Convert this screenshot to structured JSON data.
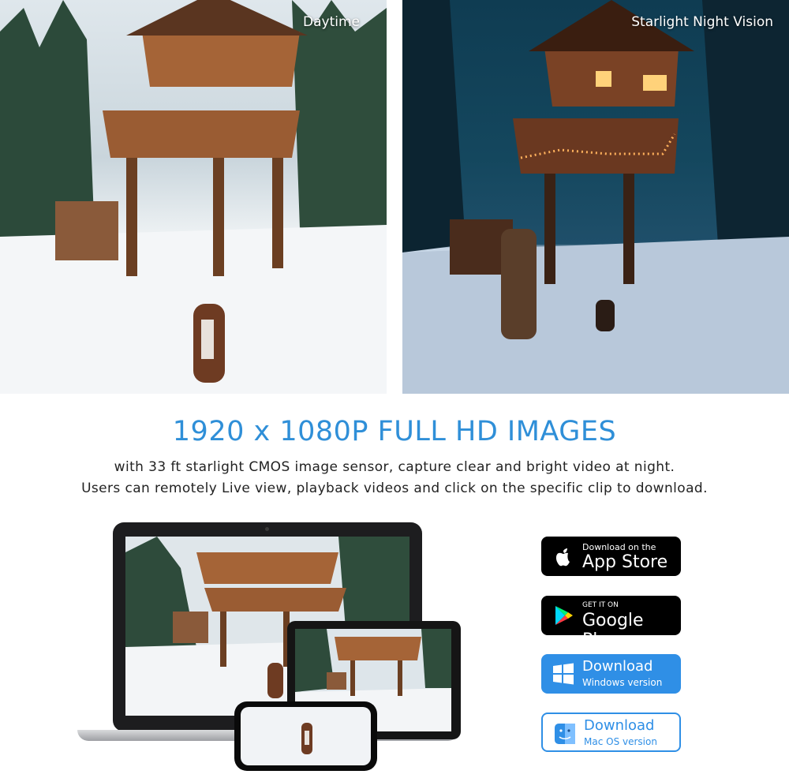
{
  "photos": {
    "day_label": "Daytime",
    "night_label": "Starlight Night Vision"
  },
  "headline": "1920 x 1080P FULL HD IMAGES",
  "description": [
    "with 33 ft starlight CMOS image sensor, capture clear and bright video at night.",
    "Users can remotely Live view, playback videos and click on the specific clip to download."
  ],
  "downloads": {
    "app_store": {
      "small": "Download on the",
      "big": "App Store",
      "icon": "apple-icon"
    },
    "google_play": {
      "small": "GET IT ON",
      "big": "Google Play",
      "icon": "google-play-icon"
    },
    "windows": {
      "big": "Download",
      "small": "Windows version",
      "icon": "windows-icon"
    },
    "mac": {
      "big": "Download",
      "small": "Mac OS version",
      "icon": "finder-icon"
    }
  },
  "colors": {
    "accent": "#2f8fd8",
    "button_blue": "#2f8fe6"
  }
}
